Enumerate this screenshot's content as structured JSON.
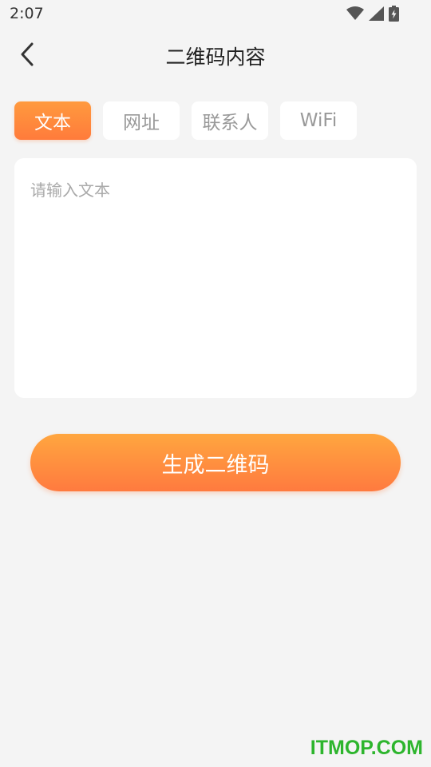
{
  "status_bar": {
    "time": "2:07"
  },
  "app_bar": {
    "back_icon": "chevron-left-icon",
    "title": "二维码内容"
  },
  "tabs": [
    {
      "label": "文本",
      "active": true
    },
    {
      "label": "网址",
      "active": false
    },
    {
      "label": "联系人",
      "active": false
    },
    {
      "label": "WiFi",
      "active": false
    }
  ],
  "input": {
    "placeholder": "请输入文本",
    "value": ""
  },
  "generate_button": {
    "label": "生成二维码"
  },
  "watermark": {
    "text": "ITMOP.COM"
  },
  "colors": {
    "accent_start": "#ffa63f",
    "accent_end": "#ff7a3f",
    "background": "#f4f4f4",
    "watermark": "#2db52d"
  }
}
